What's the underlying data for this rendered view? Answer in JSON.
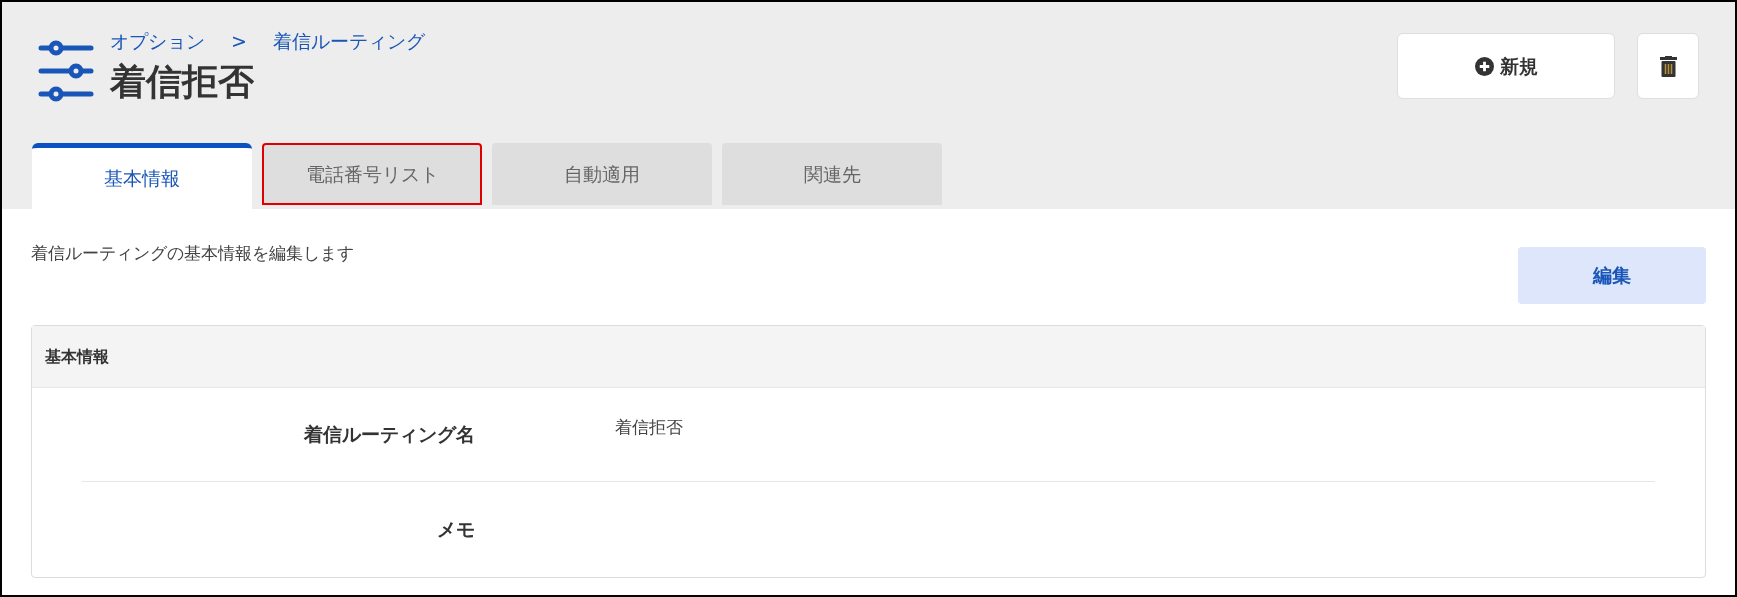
{
  "breadcrumb": [
    "オプション",
    "着信ルーティング"
  ],
  "breadcrumb_separator": ">",
  "title": "着信拒否",
  "header_buttons": [
    {
      "kind": "new",
      "label": "新規"
    },
    {
      "kind": "delete"
    }
  ],
  "tabs": [
    {
      "label": "基本情報",
      "selected": true,
      "highlighted": false
    },
    {
      "label": "電話番号リスト",
      "selected": false,
      "highlighted": true
    },
    {
      "label": "自動適用",
      "selected": false,
      "highlighted": false
    },
    {
      "label": "関連先",
      "selected": false,
      "highlighted": false
    }
  ],
  "description": "着信ルーティングの基本情報を編集します",
  "edit_button": "編集",
  "panel": {
    "title": "基本情報",
    "fields": [
      {
        "label": "着信ルーティング名",
        "value": "着信拒否"
      },
      {
        "label": "メモ"
      }
    ]
  }
}
